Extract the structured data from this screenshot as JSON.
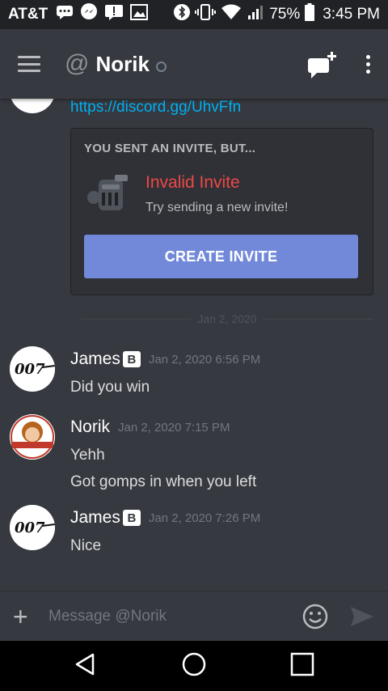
{
  "status_bar": {
    "carrier": "AT&T",
    "battery": "75%",
    "time": "3:45 PM"
  },
  "header": {
    "title": "Norik"
  },
  "chat": {
    "link": "https://discord.gg/UhvFfn",
    "invite": {
      "heading": "YOU SENT AN INVITE, BUT...",
      "title": "Invalid Invite",
      "subtitle": "Try sending a new invite!",
      "button": "CREATE INVITE"
    },
    "date_divider": "Jan 2, 2020",
    "messages": [
      {
        "author": "James",
        "badge": "B",
        "timestamp": "Jan 2, 2020 6:56 PM",
        "lines": [
          "Did you win"
        ]
      },
      {
        "author": "Norik",
        "timestamp": "Jan 2, 2020 7:15 PM",
        "lines": [
          "Yehh",
          "Got gomps in when you left"
        ]
      },
      {
        "author": "James",
        "badge": "B",
        "timestamp": "Jan 2, 2020 7:26 PM",
        "lines": [
          "Nice"
        ]
      }
    ]
  },
  "composer": {
    "placeholder": "Message @Norik"
  },
  "colors": {
    "background": "#36393f",
    "accent": "#7289da",
    "error": "#f04747",
    "link": "#00b0f4"
  }
}
